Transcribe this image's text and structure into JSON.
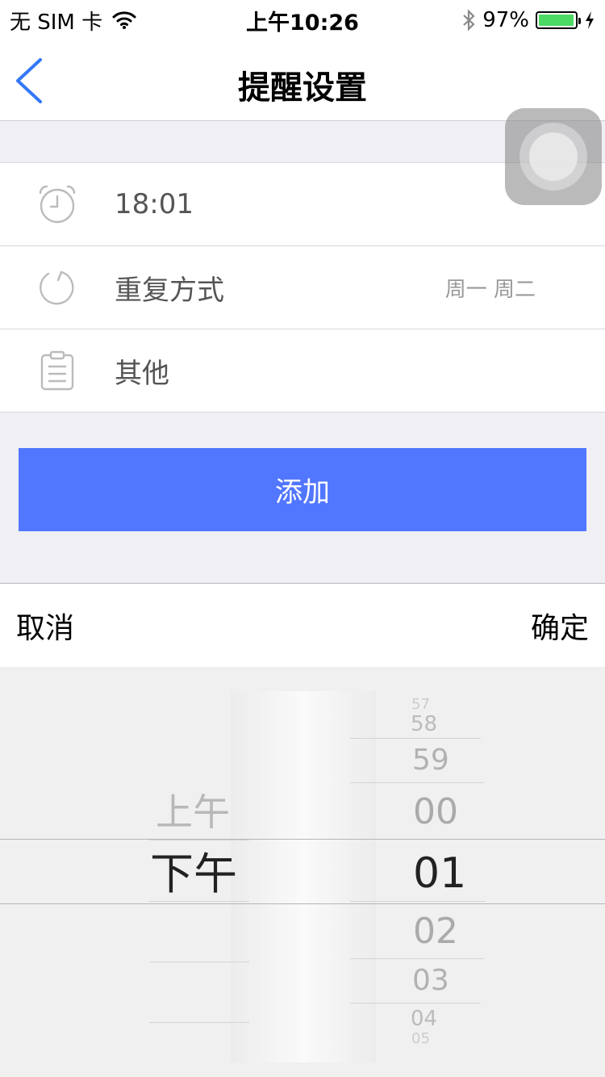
{
  "status_bar": {
    "carrier": "无 SIM 卡",
    "time": "上午10:26",
    "battery": "97%",
    "battery_level": 0.97
  },
  "nav": {
    "title": "提醒设置"
  },
  "rows": [
    {
      "label": "18:01",
      "value": ""
    },
    {
      "label": "重复方式",
      "value": "周一 周二"
    },
    {
      "label": "其他",
      "value": ""
    }
  ],
  "add_button": "添加",
  "picker": {
    "cancel": "取消",
    "confirm": "确定",
    "period": {
      "above": "上午",
      "selected": "下午"
    },
    "minutes": {
      "m57": "57",
      "m58": "58",
      "m59": "59",
      "m00": "00",
      "selected": "01",
      "m02": "02",
      "m03": "03",
      "m04": "04",
      "m05": "05"
    }
  },
  "colors": {
    "accent": "#5176ff",
    "back_arrow": "#3478f6",
    "battery": "#4cd964"
  },
  "icons": {
    "row0": "alarm-clock-icon",
    "row1": "repeat-icon",
    "row2": "clipboard-icon"
  }
}
